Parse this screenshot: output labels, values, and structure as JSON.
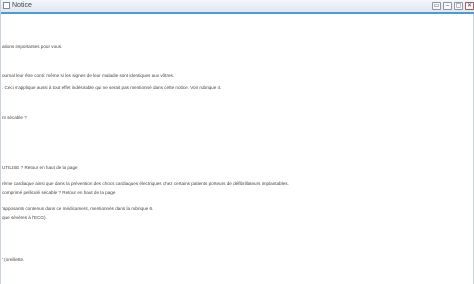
{
  "window": {
    "title": "Notice",
    "buttons": [
      "▭",
      "–",
      "▢",
      "✕"
    ]
  },
  "content": {
    "lines": [
      "ations importantes pour vous.",
      "ournal leur être conti: même si les signes de leur maladie sont identiques aux vôtres.",
      ". Ceci s'applique aussi à tout effet indésirable qui ne serait pas mentionné dans cette notice. Voir rubrique 4.",
      "nt sécable ?",
      "UTILISE ? Retour en haut de la page",
      "rème cardiaque ainsi que dans la prévention des chocs cardiaques électriques chez certains patients porteurs de défibrillateurs implantables.",
      "comprimé pelliculé sécable ? Retour en haut de la page",
      "'apposants contenus dans ce médicament, mentionnés dans la rubrique 6.",
      "que sévères à l'ECG).",
      "' (oreillette."
    ]
  }
}
